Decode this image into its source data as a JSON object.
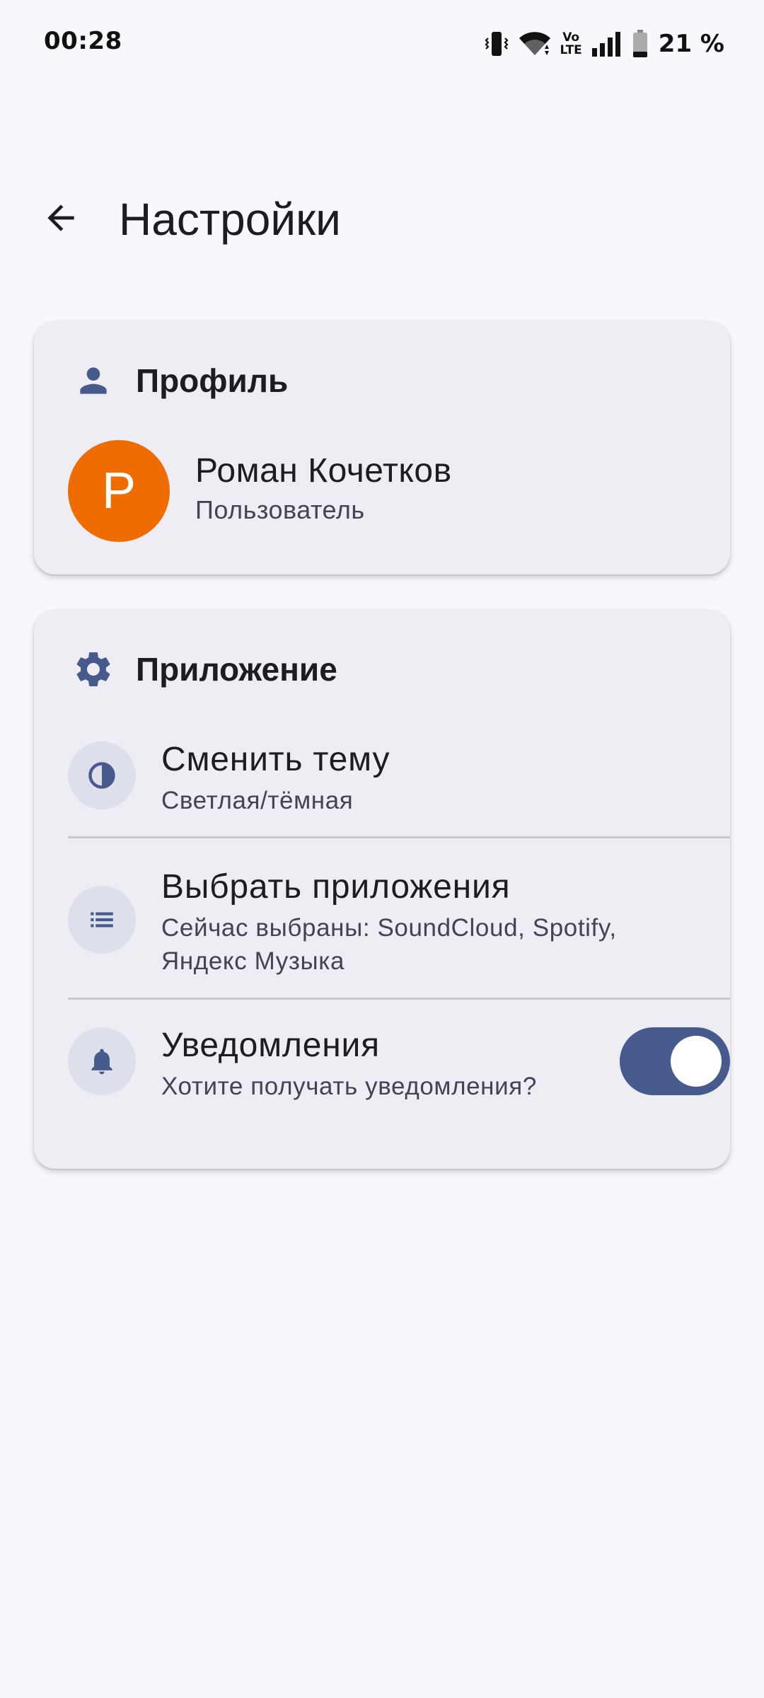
{
  "status_bar": {
    "time": "00:28",
    "icons": [
      "vibrate-icon",
      "wifi-icon",
      "volte-icon",
      "signal-icon",
      "battery-icon"
    ],
    "volte_top": "Vo",
    "volte_bottom": "LTE",
    "battery": "21 %"
  },
  "app_bar": {
    "back_icon": "arrow-back-icon",
    "title": "Настройки"
  },
  "profile_card": {
    "header_icon": "person-icon",
    "header": "Профиль",
    "avatar_letter": "Р",
    "name": "Роман Кочетков",
    "role": "Пользователь"
  },
  "app_card": {
    "header_icon": "gear-icon",
    "header": "Приложение",
    "items": [
      {
        "icon": "contrast-icon",
        "title": "Сменить тему",
        "subtitle": "Светлая/тёмная"
      },
      {
        "icon": "list-icon",
        "title": "Выбрать приложения",
        "subtitle_line1": "Сейчас выбраны: SoundCloud, Spotify,",
        "subtitle_line2": "Яндекс Музыка"
      },
      {
        "icon": "bell-icon",
        "title": "Уведомления",
        "subtitle": "Хотите получать уведомления?",
        "toggle_on": true
      }
    ]
  },
  "colors": {
    "background": "#f7f7fc",
    "card": "#eeedf3",
    "accent": "#465a8e",
    "avatar": "#ef6c00",
    "icon_circle": "#dddfeb"
  }
}
